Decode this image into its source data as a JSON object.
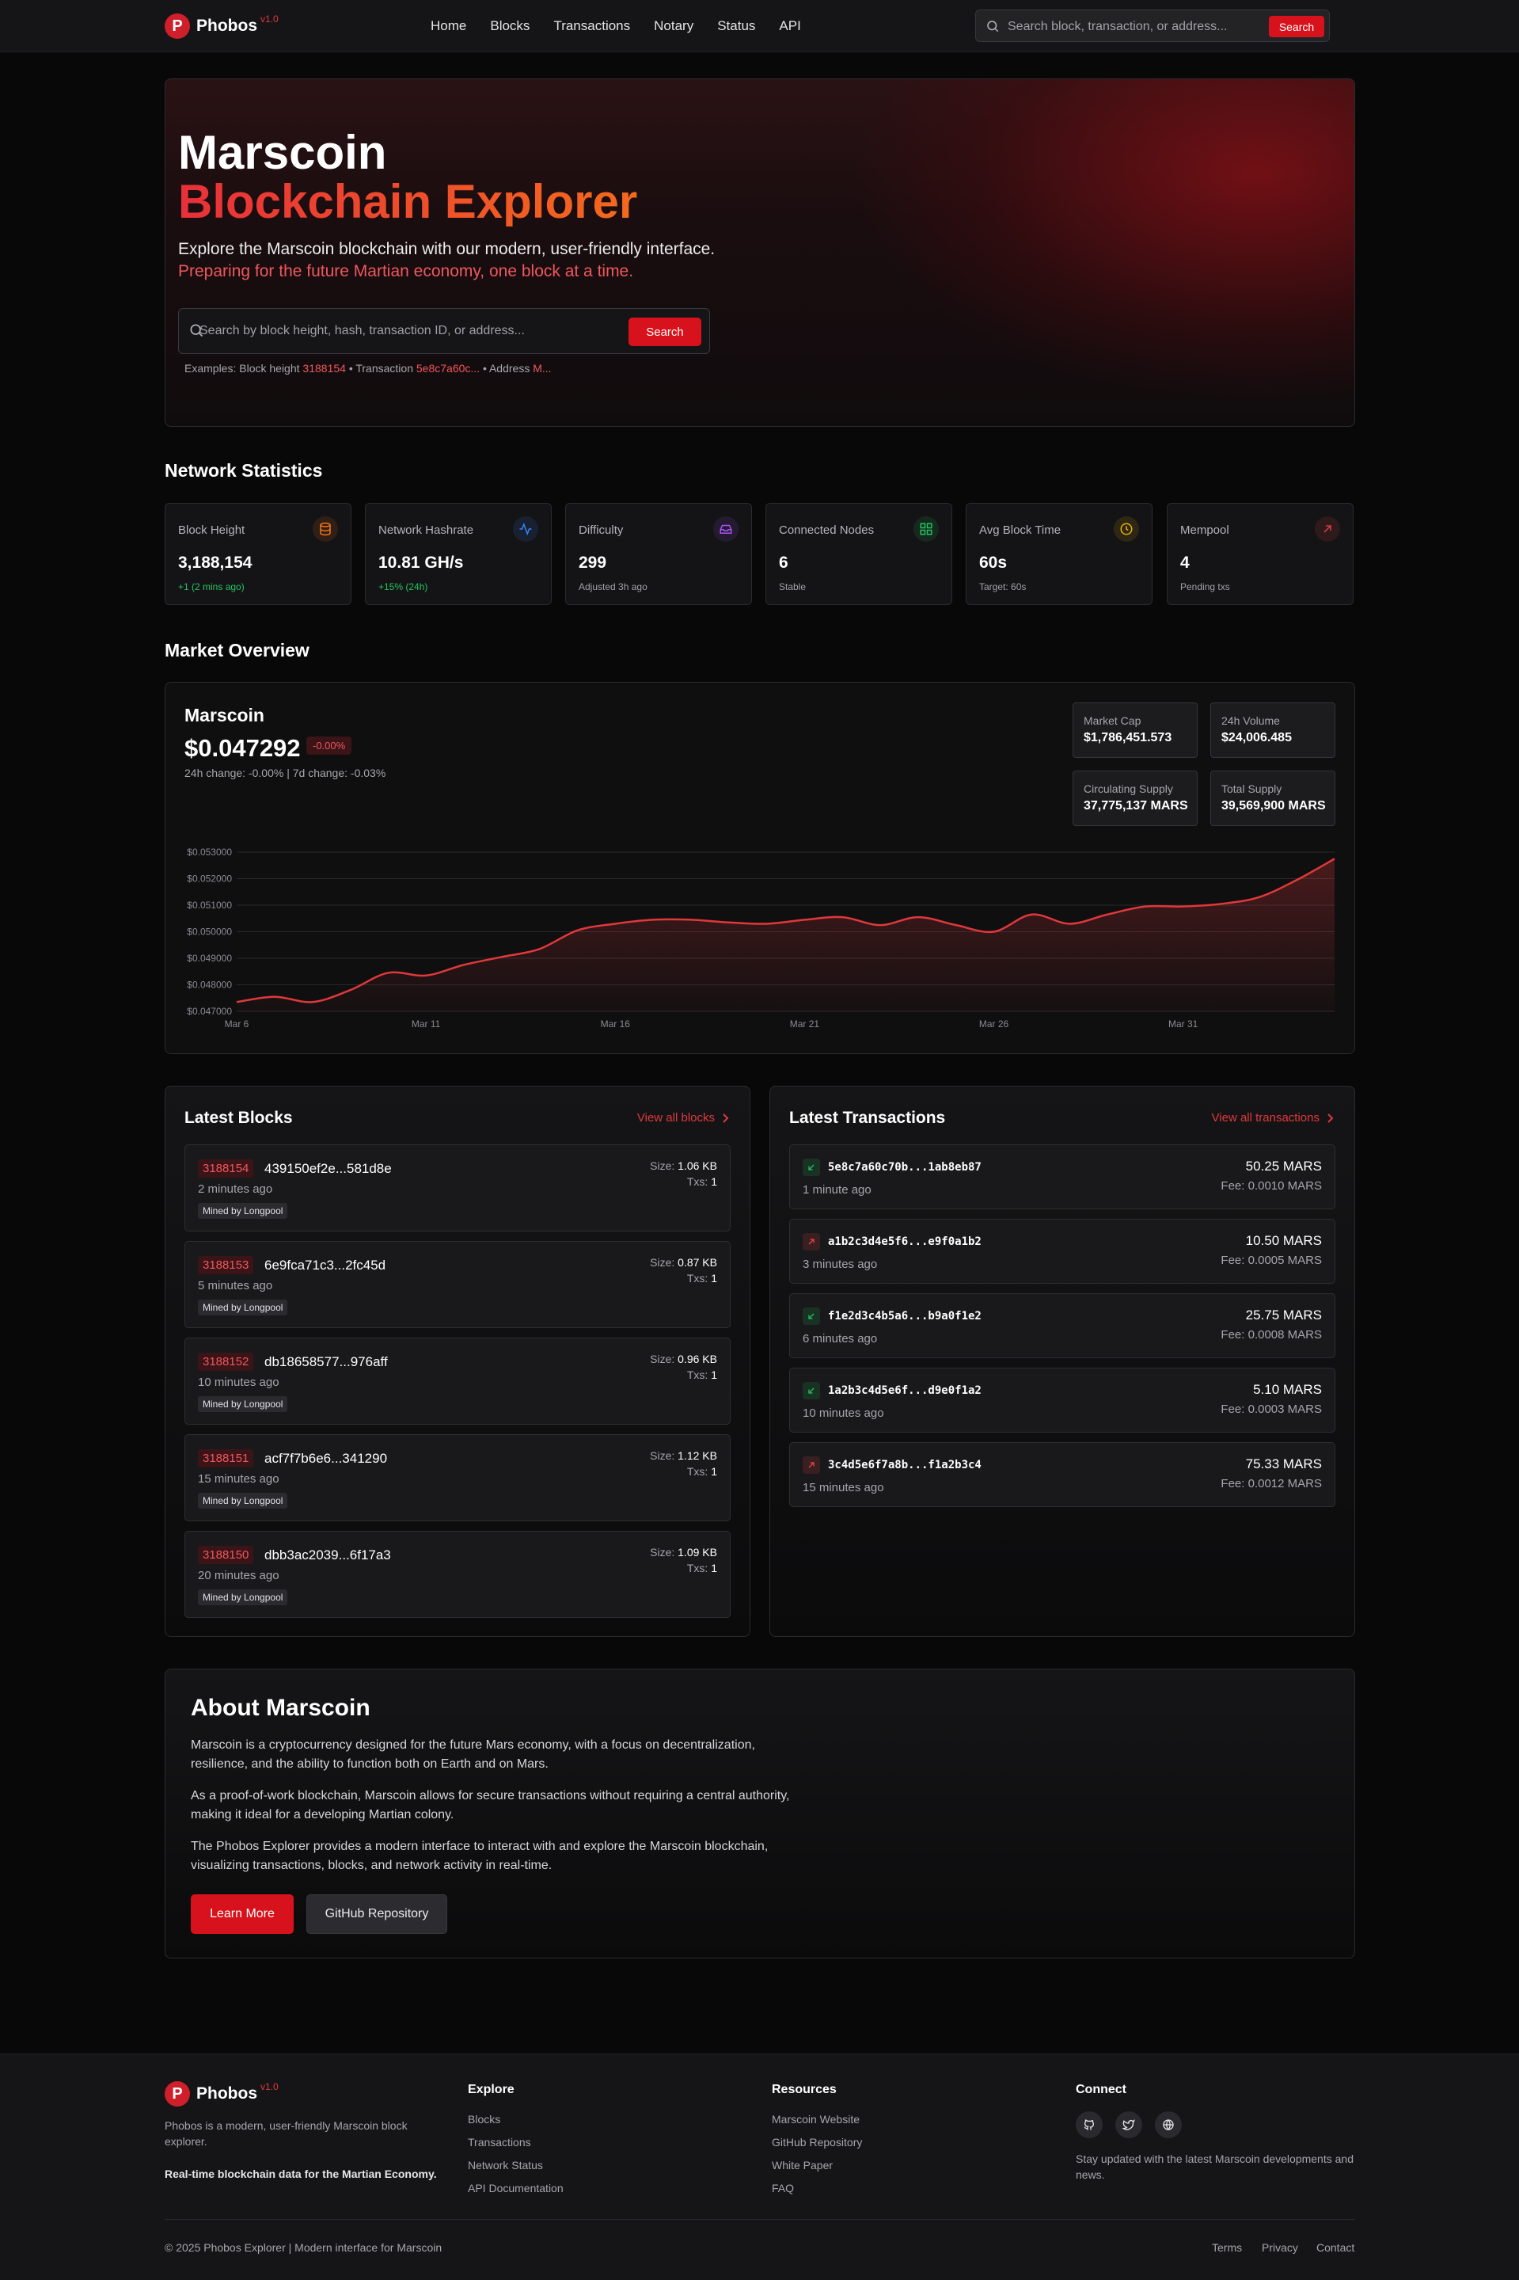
{
  "brand": {
    "name": "Phobos",
    "version": "v1.0",
    "logo_letter": "P"
  },
  "nav": {
    "links": [
      "Home",
      "Blocks",
      "Transactions",
      "Notary",
      "Status",
      "API"
    ],
    "search_placeholder": "Search block, transaction, or address...",
    "search_button": "Search"
  },
  "hero": {
    "title_line1": "Marscoin",
    "title_line2": "Blockchain Explorer",
    "subtitle": "Explore the Marscoin blockchain with our modern, user-friendly interface.",
    "tagline": "Preparing for the future Martian economy, one block at a time.",
    "search_placeholder": "Search by block height, hash, transaction ID, or address...",
    "search_button": "Search",
    "examples_prefix": "Examples: Block height",
    "example_block": "3188154",
    "examples_tx_label": "• Transaction",
    "example_tx": "5e8c7a60c...",
    "examples_addr_label": "• Address",
    "example_addr": "M..."
  },
  "network": {
    "title": "Network Statistics",
    "stats": [
      {
        "label": "Block Height",
        "value": "3,188,154",
        "sub": "+1 (2 mins ago)",
        "icon": "database-icon",
        "color": "#f97316"
      },
      {
        "label": "Network Hashrate",
        "value": "10.81 GH/s",
        "sub": "+15% (24h)",
        "icon": "activity-icon",
        "color": "#3b82f6"
      },
      {
        "label": "Difficulty",
        "value": "299",
        "sub": "Adjusted 3h ago",
        "icon": "inbox-icon",
        "color": "#a855f7"
      },
      {
        "label": "Connected Nodes",
        "value": "6",
        "sub": "Stable",
        "icon": "grid-icon",
        "color": "#22c55e"
      },
      {
        "label": "Avg Block Time",
        "value": "60s",
        "sub": "Target: 60s",
        "icon": "clock-icon",
        "color": "#eab308"
      },
      {
        "label": "Mempool",
        "value": "4",
        "sub": "Pending txs",
        "icon": "arrow-up-right-icon",
        "color": "#ef4444"
      }
    ]
  },
  "market": {
    "title": "Market Overview",
    "coin": "Marscoin",
    "price": "$0.047292",
    "change_badge": "-0.00%",
    "change_line": "24h change: -0.00% | 7d change: -0.03%",
    "cards": [
      {
        "label": "Market Cap",
        "value": "$1,786,451.573"
      },
      {
        "label": "24h Volume",
        "value": "$24,006.485"
      },
      {
        "label": "Circulating Supply",
        "value": "37,775,137 MARS"
      },
      {
        "label": "Total Supply",
        "value": "39,569,900 MARS"
      }
    ]
  },
  "chart_data": {
    "type": "line",
    "title": "",
    "xlabel": "",
    "ylabel": "",
    "line_color": "#e0383b",
    "grid": true,
    "ylim": [
      0.047,
      0.053
    ],
    "yticks": [
      "$0.053000",
      "$0.052000",
      "$0.051000",
      "$0.050000",
      "$0.049000",
      "$0.048000",
      "$0.047000"
    ],
    "ytick_values": [
      0.053,
      0.052,
      0.051,
      0.05,
      0.049,
      0.048,
      0.047
    ],
    "xticks": [
      "Mar 6",
      "Mar 11",
      "Mar 16",
      "Mar 21",
      "Mar 26",
      "Mar 31"
    ],
    "xtick_positions": [
      0,
      5,
      10,
      15,
      20,
      25
    ],
    "x": [
      0,
      1,
      2,
      3,
      4,
      5,
      6,
      7,
      8,
      9,
      10,
      11,
      12,
      13,
      14,
      15,
      16,
      17,
      18,
      19,
      20,
      21,
      22,
      23,
      24,
      25,
      26,
      27,
      28,
      29
    ],
    "values": [
      0.04735,
      0.04755,
      0.04735,
      0.0478,
      0.04845,
      0.04835,
      0.04875,
      0.04905,
      0.04935,
      0.05005,
      0.0503,
      0.05045,
      0.05045,
      0.05035,
      0.0503,
      0.05045,
      0.05055,
      0.05025,
      0.05055,
      0.05025,
      0.05,
      0.05065,
      0.0503,
      0.05065,
      0.05095,
      0.05095,
      0.05105,
      0.0513,
      0.05195,
      0.05275
    ]
  },
  "blocks": {
    "title": "Latest Blocks",
    "view_all": "View all blocks",
    "items": [
      {
        "height": "3188154",
        "hash": "439150ef2e...581d8e",
        "age": "2 minutes ago",
        "miner": "Mined by Longpool",
        "size_label": "Size:",
        "size": "1.06 KB",
        "txs_label": "Txs:",
        "txs": "1"
      },
      {
        "height": "3188153",
        "hash": "6e9fca71c3...2fc45d",
        "age": "5 minutes ago",
        "miner": "Mined by Longpool",
        "size_label": "Size:",
        "size": "0.87 KB",
        "txs_label": "Txs:",
        "txs": "1"
      },
      {
        "height": "3188152",
        "hash": "db18658577...976aff",
        "age": "10 minutes ago",
        "miner": "Mined by Longpool",
        "size_label": "Size:",
        "size": "0.96 KB",
        "txs_label": "Txs:",
        "txs": "1"
      },
      {
        "height": "3188151",
        "hash": "acf7f7b6e6...341290",
        "age": "15 minutes ago",
        "miner": "Mined by Longpool",
        "size_label": "Size:",
        "size": "1.12 KB",
        "txs_label": "Txs:",
        "txs": "1"
      },
      {
        "height": "3188150",
        "hash": "dbb3ac2039...6f17a3",
        "age": "20 minutes ago",
        "miner": "Mined by Longpool",
        "size_label": "Size:",
        "size": "1.09 KB",
        "txs_label": "Txs:",
        "txs": "1"
      }
    ]
  },
  "transactions": {
    "title": "Latest Transactions",
    "view_all": "View all transactions",
    "items": [
      {
        "hash": "5e8c7a60c70b...1ab8eb87",
        "age": "1 minute ago",
        "amount": "50.25 MARS",
        "fee": "Fee: 0.0010 MARS",
        "direction": "in",
        "icon": "arrow-down-left-icon"
      },
      {
        "hash": "a1b2c3d4e5f6...e9f0a1b2",
        "age": "3 minutes ago",
        "amount": "10.50 MARS",
        "fee": "Fee: 0.0005 MARS",
        "direction": "out",
        "icon": "arrow-up-right-icon"
      },
      {
        "hash": "f1e2d3c4b5a6...b9a0f1e2",
        "age": "6 minutes ago",
        "amount": "25.75 MARS",
        "fee": "Fee: 0.0008 MARS",
        "direction": "in",
        "icon": "arrow-down-left-icon"
      },
      {
        "hash": "1a2b3c4d5e6f...d9e0f1a2",
        "age": "10 minutes ago",
        "amount": "5.10 MARS",
        "fee": "Fee: 0.0003 MARS",
        "direction": "in",
        "icon": "arrow-down-left-icon"
      },
      {
        "hash": "3c4d5e6f7a8b...f1a2b3c4",
        "age": "15 minutes ago",
        "amount": "75.33 MARS",
        "fee": "Fee: 0.0012 MARS",
        "direction": "out",
        "icon": "arrow-up-right-icon"
      }
    ]
  },
  "about": {
    "title": "About Marscoin",
    "paragraphs": [
      "Marscoin is a cryptocurrency designed for the future Mars economy, with a focus on decentralization, resilience, and the ability to function both on Earth and on Mars.",
      "As a proof-of-work blockchain, Marscoin allows for secure transactions without requiring a central authority, making it ideal for a developing Martian colony.",
      "The Phobos Explorer provides a modern interface to interact with and explore the Marscoin blockchain, visualizing transactions, blocks, and network activity in real-time."
    ],
    "learn_more": "Learn More",
    "github": "GitHub Repository"
  },
  "footer": {
    "description": "Phobos is a modern, user-friendly Marscoin block explorer.",
    "tagline": "Real-time blockchain data for the Martian Economy.",
    "explore": {
      "title": "Explore",
      "links": [
        "Blocks",
        "Transactions",
        "Network Status",
        "API Documentation"
      ]
    },
    "resources": {
      "title": "Resources",
      "links": [
        "Marscoin Website",
        "GitHub Repository",
        "White Paper",
        "FAQ"
      ]
    },
    "connect": {
      "title": "Connect",
      "text": "Stay updated with the latest Marscoin developments and news.",
      "icons": [
        "github-icon",
        "twitter-icon",
        "globe-icon"
      ]
    },
    "copyright": "© 2025 Phobos Explorer | Modern interface for Marscoin",
    "legal": [
      "Terms",
      "Privacy",
      "Contact"
    ]
  },
  "colors": {
    "accent": "#d8121c",
    "accent_text": "#e0383b",
    "background": "#080809",
    "positive": "#22c55e"
  }
}
